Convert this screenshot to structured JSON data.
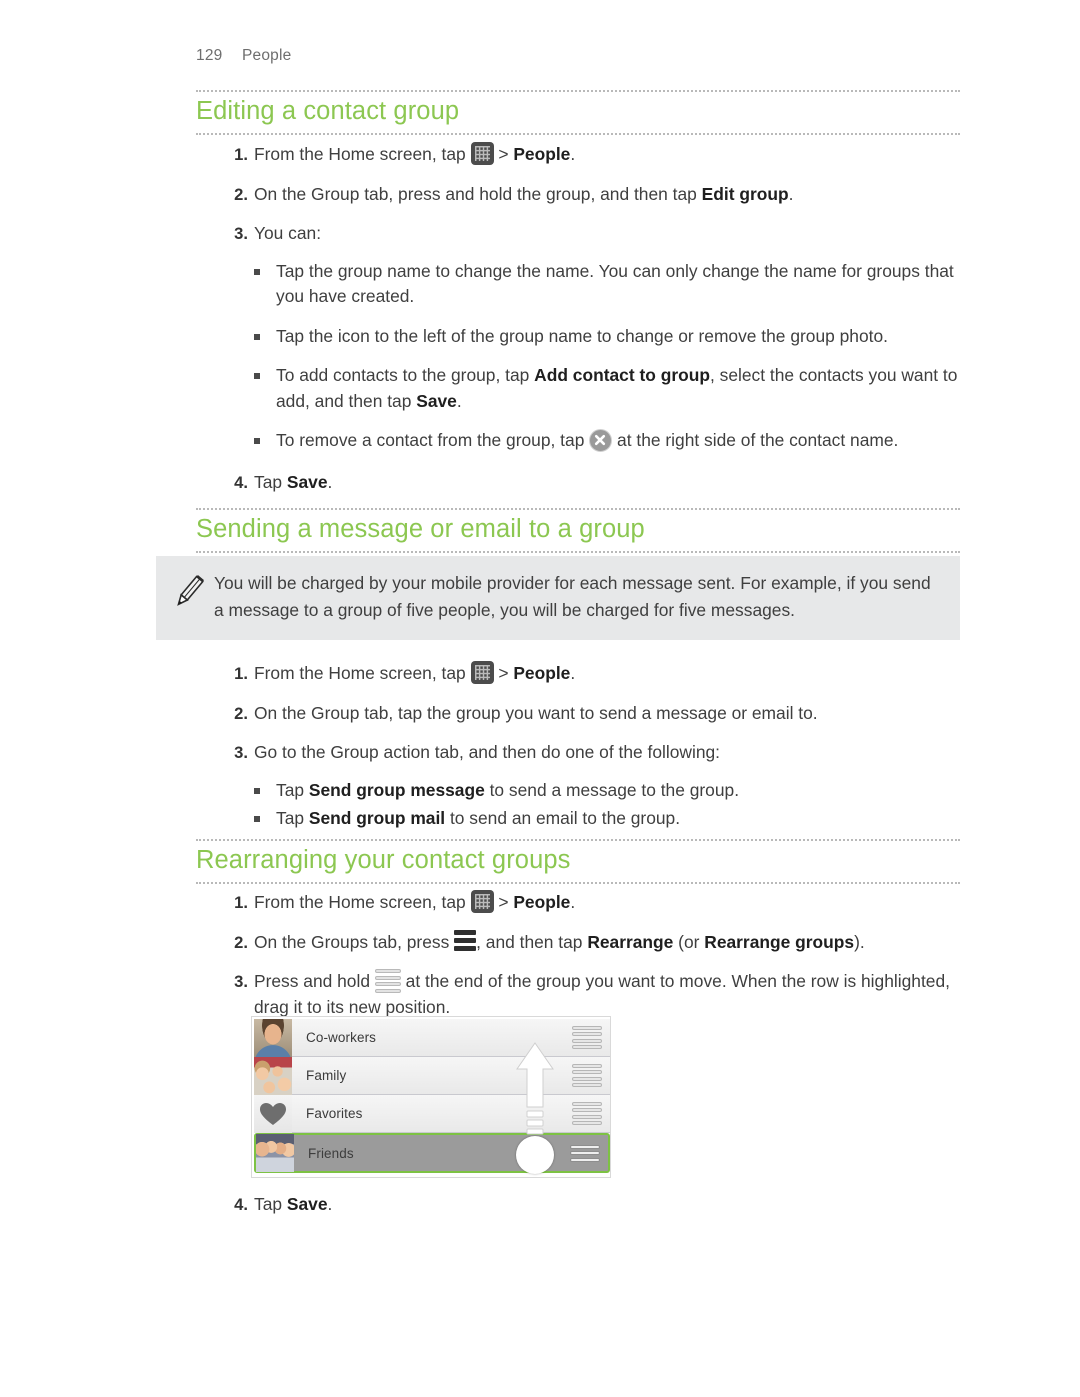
{
  "header": {
    "page_number": "129",
    "chapter": "People"
  },
  "sections": [
    {
      "id": "editing",
      "title": "Editing a contact group",
      "steps": [
        {
          "num": "1.",
          "pre": "From the Home screen, tap ",
          "icon": "apps-icon",
          "post_plain": " > ",
          "post_bold": "People",
          "tail": "."
        },
        {
          "num": "2.",
          "text_pre": "On the Group tab, press and hold the group, and then tap ",
          "bold": "Edit group",
          "text_post": "."
        },
        {
          "num": "3.",
          "text_pre": "You can:",
          "bold": "",
          "text_post": ""
        },
        {
          "num": "4.",
          "text_pre": "Tap ",
          "bold": "Save",
          "text_post": "."
        }
      ],
      "bullets": [
        {
          "pre": "Tap the group name to change the name. You can only change the name for groups that you have created.",
          "bold": "",
          "post": ""
        },
        {
          "pre": "Tap the icon to the left of the group name to change or remove the group photo.",
          "bold": "",
          "post": ""
        },
        {
          "pre": "To add contacts to the group, tap ",
          "bold": "Add contact to group",
          "post": ", select the contacts you want to add, and then tap ",
          "bold2": "Save",
          "post2": "."
        },
        {
          "pre": "To remove a contact from the group, tap ",
          "icon": "remove-x-icon",
          "post": " at the right side of the contact name."
        }
      ]
    },
    {
      "id": "sending",
      "title": "Sending a message or email to a group",
      "note": "You will be charged by your mobile provider for each message sent. For example, if you send a message to a group of five people, you will be charged for five messages.",
      "note_icon": "pencil-icon",
      "steps": [
        {
          "num": "1.",
          "pre": "From the Home screen, tap ",
          "icon": "apps-icon",
          "post_plain": " > ",
          "post_bold": "People",
          "tail": "."
        },
        {
          "num": "2.",
          "text_pre": "On the Group tab, tap the group you want to send a message or email to.",
          "bold": "",
          "text_post": ""
        },
        {
          "num": "3.",
          "text_pre": "Go to the Group action tab, and then do one of the following:",
          "bold": "",
          "text_post": ""
        }
      ],
      "bullets": [
        {
          "pre": "Tap ",
          "bold": "Send group message",
          "post": " to send a message to the group."
        },
        {
          "pre": "Tap ",
          "bold": "Send group mail",
          "post": " to send an email to the group."
        }
      ]
    },
    {
      "id": "rearranging",
      "title": "Rearranging your contact groups",
      "steps": [
        {
          "num": "1.",
          "pre": "From the Home screen, tap ",
          "icon": "apps-icon",
          "post_plain": " > ",
          "post_bold": "People",
          "tail": "."
        },
        {
          "num": "2.",
          "pre2": "On the Groups tab, press ",
          "icon2": "menu-icon",
          "mid": ", and then tap ",
          "bold": "Rearrange",
          "mid2": " (or ",
          "bold2": "Rearrange groups",
          "tail": ")."
        },
        {
          "num": "3.",
          "pre3": "Press and hold ",
          "icon3": "drag-handle-icon",
          "post3": " at the end of the group you want to move. When the row is highlighted, drag it to its new position."
        },
        {
          "num": "4.",
          "text_pre": "Tap ",
          "bold": "Save",
          "text_post": "."
        }
      ]
    }
  ],
  "screenshot": {
    "caption": "",
    "rows": [
      {
        "label": "Co-workers",
        "avatar": "man-photo",
        "selected": false
      },
      {
        "label": "Family",
        "avatar": "family-photo",
        "selected": false
      },
      {
        "label": "Favorites",
        "avatar": "heart-icon",
        "selected": false
      },
      {
        "label": "Friends",
        "avatar": "friends-photo",
        "selected": true
      }
    ],
    "gesture": {
      "arrow": "drag-up-arrow",
      "touch": "finger-touch-indicator"
    }
  },
  "colors": {
    "heading_green": "#8cc751",
    "note_background": "#e7e8e9",
    "selection_green": "#7dc243",
    "body_text": "#3f3f3f"
  }
}
